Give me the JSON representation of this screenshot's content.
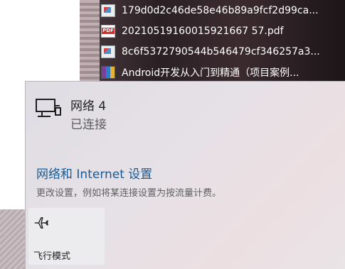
{
  "files": [
    {
      "icon": "image-file-icon",
      "name": "179d0d2c46de58e46b89a9fcf2d99ca..."
    },
    {
      "icon": "pdf-file-icon",
      "name": "20210519160015921667 57.pdf"
    },
    {
      "icon": "image-file-icon",
      "name": "8c6f5372790544b546479cf346257a3..."
    },
    {
      "icon": "archive-file-icon",
      "name": "Android开发从入门到精通（项目案例..."
    }
  ],
  "network": {
    "icon": "wired-network-icon",
    "name": "网络 4",
    "status": "已连接"
  },
  "settings": {
    "link": "网络和 Internet 设置",
    "description": "更改设置，例如将某连接设置为按流量计费。"
  },
  "quick_actions": [
    {
      "icon": "airplane-icon",
      "label": "飞行模式"
    }
  ]
}
